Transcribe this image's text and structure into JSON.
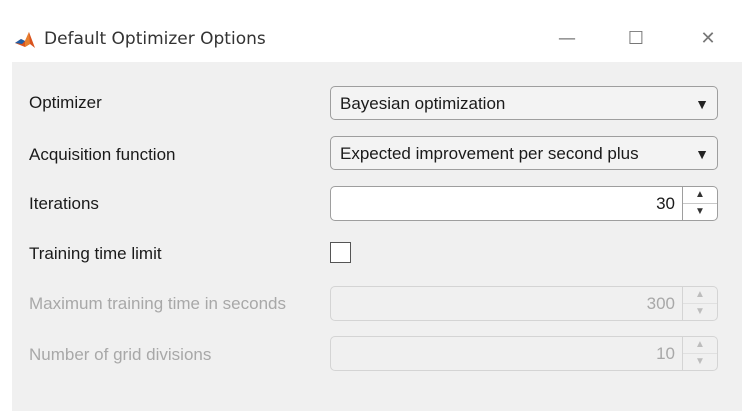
{
  "window": {
    "title": "Default Optimizer Options",
    "icon": "matlab-icon",
    "controls": {
      "minimize": "—",
      "maximize": "☐",
      "close": "✕"
    }
  },
  "form": {
    "optimizer": {
      "label": "Optimizer",
      "value": "Bayesian optimization"
    },
    "acquisition": {
      "label": "Acquisition function",
      "value": "Expected improvement per second plus"
    },
    "iterations": {
      "label": "Iterations",
      "value": "30"
    },
    "time_limit": {
      "label": "Training time limit",
      "checked": false
    },
    "max_time": {
      "label": "Maximum training time in seconds",
      "value": "300",
      "enabled": false
    },
    "grid_divisions": {
      "label": "Number of grid divisions",
      "value": "10",
      "enabled": false
    }
  },
  "glyphs": {
    "dropdown_arrow": "▼",
    "spin_up": "▲",
    "spin_down": "▼"
  },
  "colors": {
    "panel_bg": "#f0f0f0",
    "disabled_text": "#a8a8a8"
  }
}
